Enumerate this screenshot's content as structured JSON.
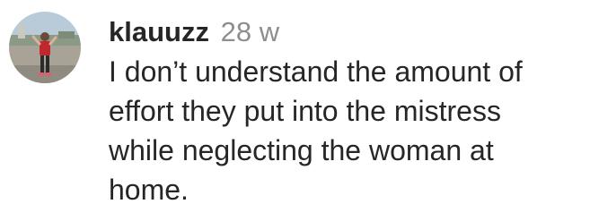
{
  "comment": {
    "avatar_icon": "user-avatar-photo",
    "username": "klauuzz",
    "timestamp": "28 w",
    "text": "I don’t understand the amount of\neffort they put into the mistress\nwhile neglecting the woman at\nhome."
  }
}
